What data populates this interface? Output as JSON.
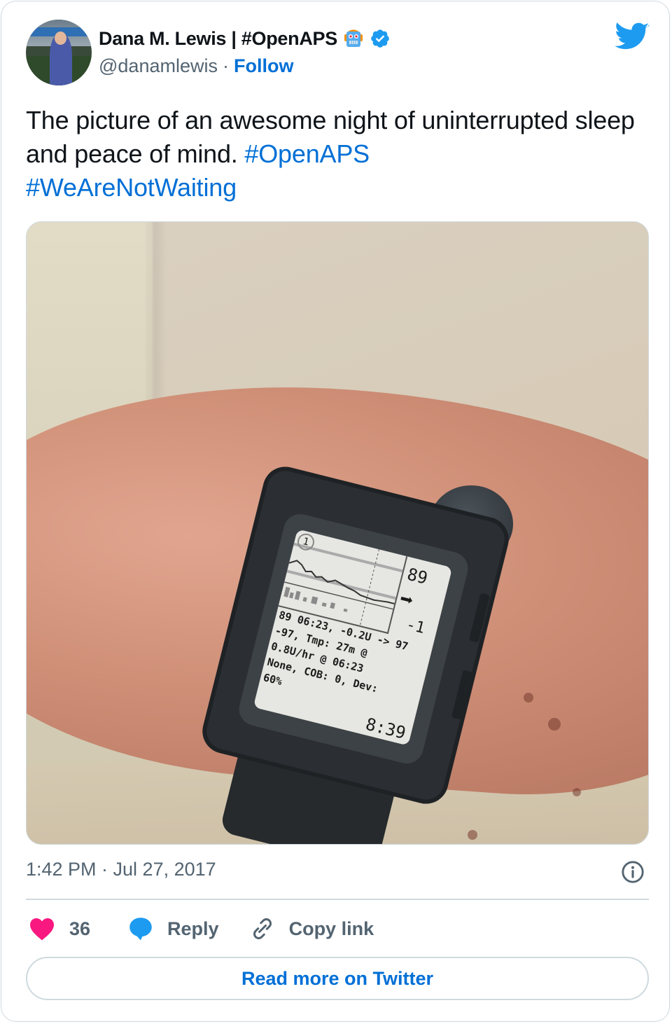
{
  "author": {
    "display_name": "Dana M. Lewis | #OpenAPS",
    "handle": "@danamlewis",
    "separator": "·",
    "follow_label": "Follow",
    "avatar_icon": "profile-photo",
    "name_emoji_icon": "robot-face-icon",
    "verified_icon": "verified-badge-icon"
  },
  "brand": {
    "logo_icon": "twitter-bird-icon",
    "accent_color": "#1d9bf0",
    "link_color": "#006fd6"
  },
  "tweet": {
    "text": "The picture of an awesome night of uninterrupted sleep and peace of mind. ",
    "hashtags": [
      "#OpenAPS",
      "#WeAreNotWaiting"
    ],
    "photo": {
      "description": "Pebble smartwatch on a wrist showing OpenAPS glucose data",
      "screen": {
        "badge": "1",
        "bg_value": "89",
        "trend_arrow": "➡",
        "delta": "-1",
        "status_lines": [
          "89 06:23, -0.2U -> 97",
          "-97, Tmp: 27m @",
          "0.8U/hr @ 06:23",
          "None, COB: 0, Dev:",
          "60%"
        ],
        "clock": "8:39"
      }
    },
    "timestamp": "1:42 PM · Jul 27, 2017",
    "info_icon": "info-icon"
  },
  "actions": {
    "like": {
      "icon": "heart-icon",
      "count": "36",
      "color": "#f91880"
    },
    "reply": {
      "icon": "speech-bubble-icon",
      "label": "Reply",
      "color": "#1d9bf0"
    },
    "copy_link": {
      "icon": "link-icon",
      "label": "Copy link"
    }
  },
  "read_more_label": "Read more on Twitter"
}
